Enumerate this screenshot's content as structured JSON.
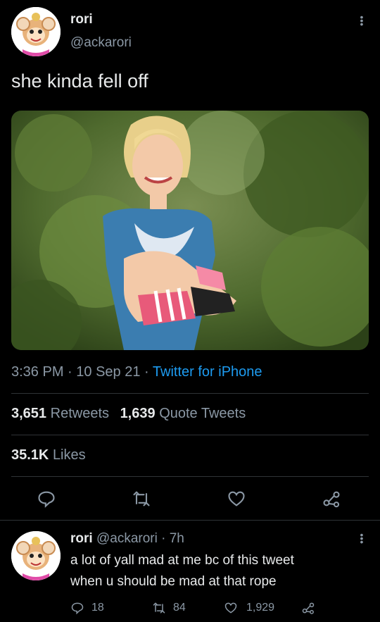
{
  "tweet": {
    "display_name": "rori",
    "handle": "@ackarori",
    "text": "she kinda fell off",
    "time": "3:36 PM",
    "date": "10 Sep 21",
    "source": "Twitter for iPhone",
    "retweets_count": "3,651",
    "retweets_label": "Retweets",
    "quotes_count": "1,639",
    "quotes_label": "Quote Tweets",
    "likes_count": "35.1K",
    "likes_label": "Likes",
    "sep": "·"
  },
  "reply": {
    "display_name": "rori",
    "handle": "@ackarori",
    "age": "7h",
    "line1": "a lot of yall mad at me bc of this tweet",
    "line2": "when u should be mad at that rope",
    "replies": "18",
    "retweets": "84",
    "likes": "1,929",
    "sep": "·"
  },
  "icons": {
    "reply": "comment-icon",
    "retweet": "retweet-icon",
    "like": "heart-icon",
    "share": "share-icon",
    "more": "more-icon"
  },
  "colors": {
    "background": "#000000",
    "text": "#e7e9ea",
    "muted": "#8b98a5",
    "link": "#1d9bf0",
    "divider": "#2f3336"
  }
}
